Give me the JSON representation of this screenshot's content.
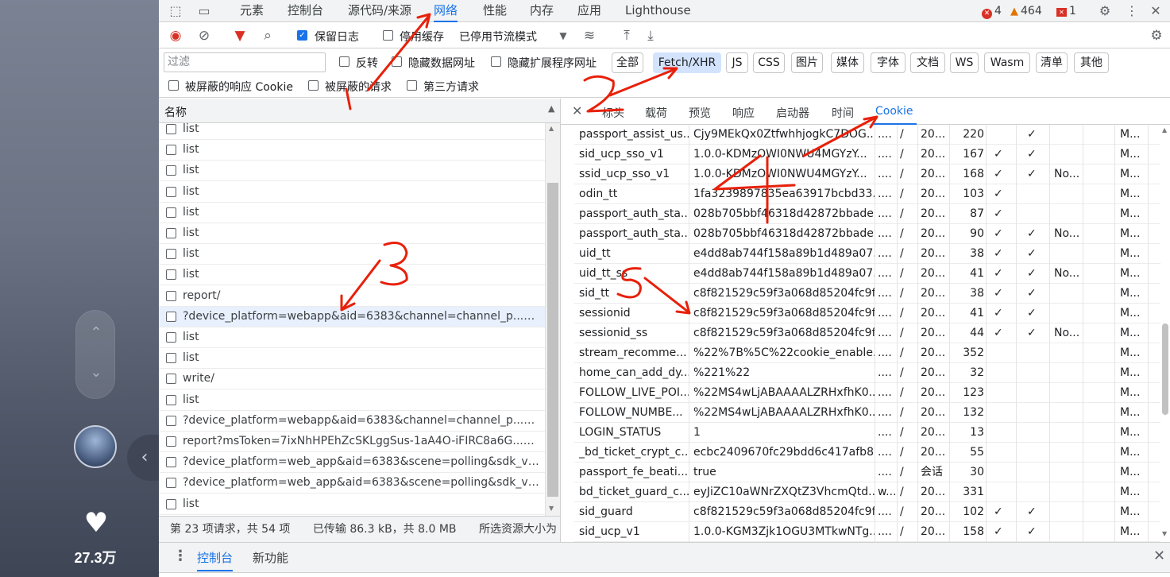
{
  "left_panel": {
    "likes": "27.3万"
  },
  "devtools": {
    "top_tabs": [
      "元素",
      "控制台",
      "源代码/来源",
      "网络",
      "性能",
      "内存",
      "应用",
      "Lighthouse"
    ],
    "active_top_tab": "网络",
    "counts": {
      "errors": "4",
      "warnings": "464",
      "issues": "1"
    },
    "toolbar": {
      "preserve_log": "保留日志",
      "disable_cache": "停用缓存",
      "throttle": "已停用节流模式"
    },
    "filter": {
      "placeholder": "过滤",
      "invert": "反转",
      "hide_data_urls": "隐藏数据网址",
      "hide_ext_urls": "隐藏扩展程序网址",
      "chips": [
        "全部",
        "Fetch/XHR",
        "JS",
        "CSS",
        "图片",
        "媒体",
        "字体",
        "文档",
        "WS",
        "Wasm",
        "清单",
        "其他"
      ],
      "active_chip": "Fetch/XHR",
      "blocked_cookies": "被屏蔽的响应 Cookie",
      "blocked_requests": "被屏蔽的请求",
      "third_party": "第三方请求"
    },
    "request_list": {
      "header": "名称",
      "rows": [
        "list",
        "list",
        "list",
        "list",
        "list",
        "list",
        "list",
        "list",
        "report/",
        "?device_platform=webapp&aid=6383&channel=channel_p...GKM...",
        "list",
        "list",
        "write/",
        "list",
        "?device_platform=webapp&aid=6383&channel=channel_p...GKM...",
        "report?msToken=7ixNhHPEhZcSKLggSus-1aA4O-iFIRC8a6G...GKM...",
        "?device_platform=web_app&aid=6383&scene=polling&sdk_versio...",
        "?device_platform=web_app&aid=6383&scene=polling&sdk_versio...",
        "list"
      ],
      "selected_index": 9
    },
    "status_bar": {
      "requests": "第 23 项请求，共 54 项",
      "transferred": "已传输 86.3 kB，共 8.0 MB",
      "resources": "所选资源大小为"
    },
    "detail_tabs": [
      "标头",
      "载荷",
      "预览",
      "响应",
      "启动器",
      "时间",
      "Cookie"
    ],
    "active_detail_tab": "Cookie",
    "cookies": [
      [
        "passport_assist_us...",
        "Cjy9MEkQx0ZtfwhhjogkC7DOG...",
        "....",
        "/",
        "20...",
        "220",
        "",
        "✓",
        "",
        "M..."
      ],
      [
        "sid_ucp_sso_v1",
        "1.0.0-KDMzOWI0NWU4MGYzY...",
        "....",
        "/",
        "20...",
        "167",
        "✓",
        "✓",
        "",
        "M..."
      ],
      [
        "ssid_ucp_sso_v1",
        "1.0.0-KDMzOWI0NWU4MGYzY...",
        "....",
        "/",
        "20...",
        "168",
        "✓",
        "✓",
        "No...",
        "M..."
      ],
      [
        "odin_tt",
        "1fa3239897835ea63917bcbd33...",
        "....",
        "/",
        "20...",
        "103",
        "✓",
        "",
        "",
        "M..."
      ],
      [
        "passport_auth_sta...",
        "028b705bbf46318d42872bbade...",
        "....",
        "/",
        "20...",
        "87",
        "✓",
        "",
        "",
        "M..."
      ],
      [
        "passport_auth_sta...",
        "028b705bbf46318d42872bbade...",
        "....",
        "/",
        "20...",
        "90",
        "✓",
        "✓",
        "No...",
        "M..."
      ],
      [
        "uid_tt",
        "e4dd8ab744f158a89b1d489a07...",
        "....",
        "/",
        "20...",
        "38",
        "✓",
        "✓",
        "",
        "M..."
      ],
      [
        "uid_tt_ss",
        "e4dd8ab744f158a89b1d489a07...",
        "....",
        "/",
        "20...",
        "41",
        "✓",
        "✓",
        "No...",
        "M..."
      ],
      [
        "sid_tt",
        "c8f821529c59f3a068d85204fc9f...",
        "....",
        "/",
        "20...",
        "38",
        "✓",
        "✓",
        "",
        "M..."
      ],
      [
        "sessionid",
        "c8f821529c59f3a068d85204fc9f...",
        "....",
        "/",
        "20...",
        "41",
        "✓",
        "✓",
        "",
        "M..."
      ],
      [
        "sessionid_ss",
        "c8f821529c59f3a068d85204fc9f...",
        "....",
        "/",
        "20...",
        "44",
        "✓",
        "✓",
        "No...",
        "M..."
      ],
      [
        "stream_recomme...",
        "%22%7B%5C%22cookie_enable...",
        "....",
        "/",
        "20...",
        "352",
        "",
        "",
        "",
        "M..."
      ],
      [
        "home_can_add_dy...",
        "%221%22",
        "....",
        "/",
        "20...",
        "32",
        "",
        "",
        "",
        "M..."
      ],
      [
        "FOLLOW_LIVE_POI...",
        "%22MS4wLjABAAAALZRHxfhK0...",
        "....",
        "/",
        "20...",
        "123",
        "",
        "",
        "",
        "M..."
      ],
      [
        "FOLLOW_NUMBE...",
        "%22MS4wLjABAAAALZRHxfhK0...",
        "....",
        "/",
        "20...",
        "132",
        "",
        "",
        "",
        "M..."
      ],
      [
        "LOGIN_STATUS",
        "1",
        "....",
        "/",
        "20...",
        "13",
        "",
        "",
        "",
        "M..."
      ],
      [
        "_bd_ticket_crypt_c...",
        "ecbc2409670fc29bdd6c417afb8...",
        "....",
        "/",
        "20...",
        "55",
        "",
        "",
        "",
        "M..."
      ],
      [
        "passport_fe_beati...",
        "true",
        "....",
        "/",
        "会话",
        "30",
        "",
        "",
        "",
        "M..."
      ],
      [
        "bd_ticket_guard_c...",
        "eyJiZC10aWNrZXQtZ3VhcmQtd...",
        "w...",
        "/",
        "20...",
        "331",
        "",
        "",
        "",
        "M..."
      ],
      [
        "sid_guard",
        "c8f821529c59f3a068d85204fc9f...",
        "....",
        "/",
        "20...",
        "102",
        "✓",
        "✓",
        "",
        "M..."
      ],
      [
        "sid_ucp_v1",
        "1.0.0-KGM3Zjk1OGU3MTkwNTg...",
        "....",
        "/",
        "20...",
        "158",
        "✓",
        "✓",
        "",
        "M..."
      ]
    ],
    "drawer": {
      "tabs": [
        "控制台",
        "新功能"
      ],
      "active": "控制台"
    }
  },
  "annotations": [
    "1",
    "2",
    "3",
    "4",
    "5"
  ],
  "colors": {
    "accent": "#1a73e8",
    "annotation": "#e8200a",
    "error": "#d93025",
    "warning": "#e37400"
  }
}
